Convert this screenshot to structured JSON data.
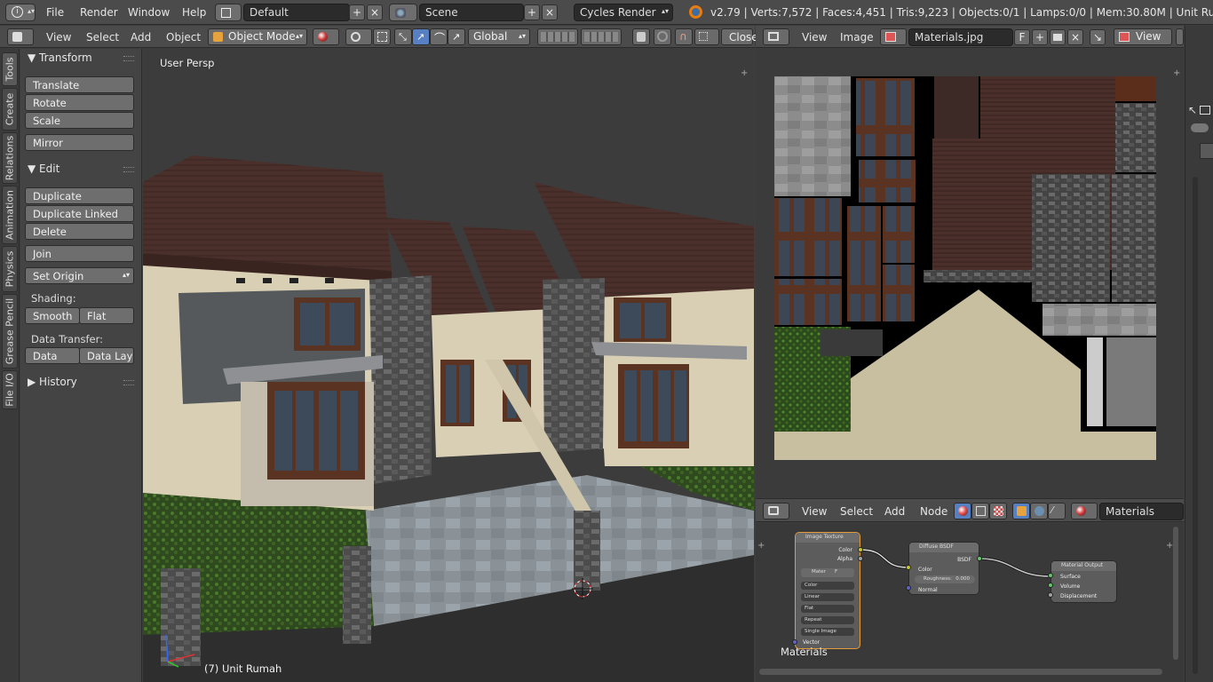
{
  "menubar": {
    "items": [
      "File",
      "Render",
      "Window",
      "Help"
    ],
    "screen_layout": "Default",
    "scene": "Scene",
    "render_engine": "Cycles Render",
    "stats": "v2.79 | Verts:7,572 | Faces:4,451 | Tris:9,223 | Objects:0/1 | Lamps:0/0 | Mem:30.80M | Unit Rumah"
  },
  "view3d_header": {
    "menus": [
      "View",
      "Select",
      "Add",
      "Object"
    ],
    "mode": "Object Mode",
    "orientation": "Global",
    "close_label": "Close"
  },
  "tool_tabs": [
    "Tools",
    "Create",
    "Relations",
    "Animation",
    "Physics",
    "Grease Pencil",
    "File I/O"
  ],
  "toolshelf": {
    "transform_title": "Transform",
    "translate": "Translate",
    "rotate": "Rotate",
    "scale": "Scale",
    "mirror": "Mirror",
    "edit_title": "Edit",
    "duplicate": "Duplicate",
    "duplicate_linked": "Duplicate Linked",
    "delete": "Delete",
    "join": "Join",
    "set_origin": "Set Origin",
    "shading_label": "Shading:",
    "smooth": "Smooth",
    "flat": "Flat",
    "data_transfer_label": "Data Transfer:",
    "data": "Data",
    "data_layout": "Data Layo",
    "history_title": "History"
  },
  "viewport": {
    "view_name": "User Persp",
    "object_label": "(7) Unit Rumah"
  },
  "image_editor": {
    "menus": [
      "View",
      "Image"
    ],
    "image_name": "Materials.jpg",
    "fake_user": "F",
    "view_mode": "View"
  },
  "node_editor": {
    "menus": [
      "View",
      "Select",
      "Add",
      "Node"
    ],
    "material_name": "Materials",
    "tree_label": "Materials",
    "image_texture_node": {
      "title": "Image Texture",
      "out_color": "Color",
      "out_alpha": "Alpha",
      "image": "Mater",
      "image_fake_user": "F",
      "color_space": "Color",
      "interpolation": "Linear",
      "projection": "Flat",
      "extension": "Repeat",
      "source": "Single Image",
      "in_vector": "Vector"
    },
    "diffuse_node": {
      "title": "Diffuse BSDF",
      "out_bsdf": "BSDF",
      "in_color": "Color",
      "roughness_label": "Roughness:",
      "roughness_value": "0.000",
      "in_normal": "Normal"
    },
    "output_node": {
      "title": "Material Output",
      "in_surface": "Surface",
      "in_volume": "Volume",
      "in_displacement": "Displacement"
    }
  },
  "colors": {
    "header_bg": "#4b4b4b",
    "panel_bg": "#444444",
    "button_bg": "#6e6e6e",
    "selection_orange": "#e29b3c",
    "manipulator_blue": "#5680c2"
  }
}
